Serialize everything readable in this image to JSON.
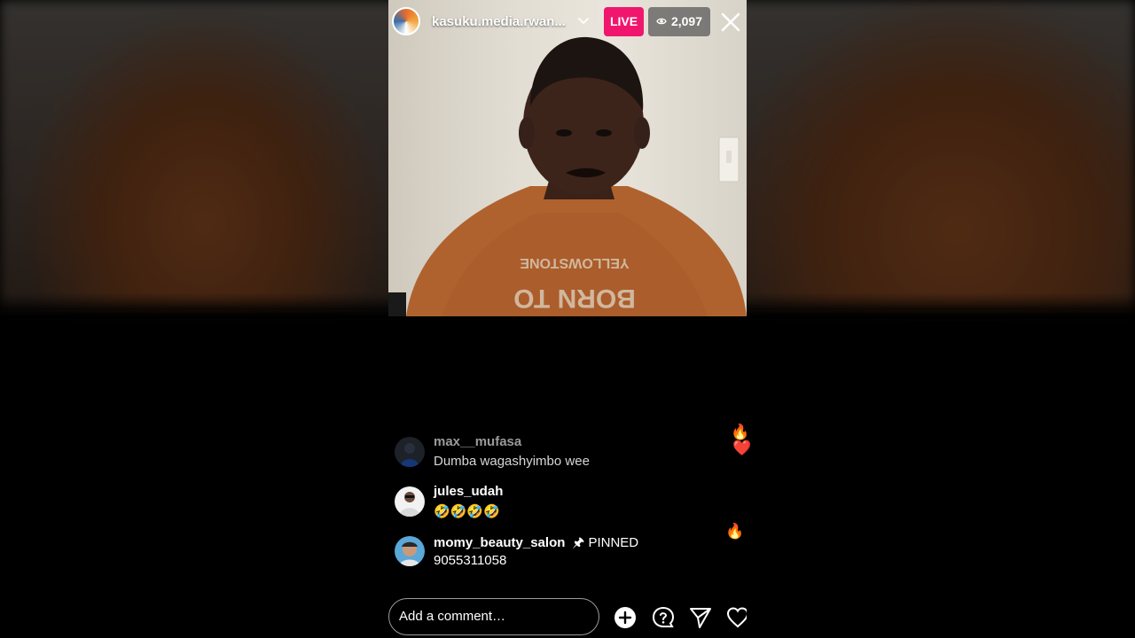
{
  "stream": {
    "username": "kasuku.media.rwan...",
    "live_label": "LIVE",
    "viewer_count": "2,097"
  },
  "comments": [
    {
      "user": "max__mufasa",
      "text": "Dumba wagashyimbo wee",
      "pinned": false
    },
    {
      "user": "jules_udah",
      "text": "🤣🤣🤣🤣",
      "pinned": false
    },
    {
      "user": "momy_beauty_salon",
      "text": "9055311058",
      "pinned": true,
      "pinned_label": "PINNED"
    }
  ],
  "reactions": [
    "🔥",
    "❤️",
    "🔥"
  ],
  "composer": {
    "placeholder": "Add a comment…"
  },
  "icons": [
    "chevron-down-icon",
    "eye-icon",
    "close-icon",
    "add-icon",
    "question-icon",
    "send-icon",
    "heart-icon",
    "pin-icon"
  ],
  "colors": {
    "live_badge": "#f0166e",
    "viewer_badge": "#5a5a5a",
    "background": "#000000"
  }
}
